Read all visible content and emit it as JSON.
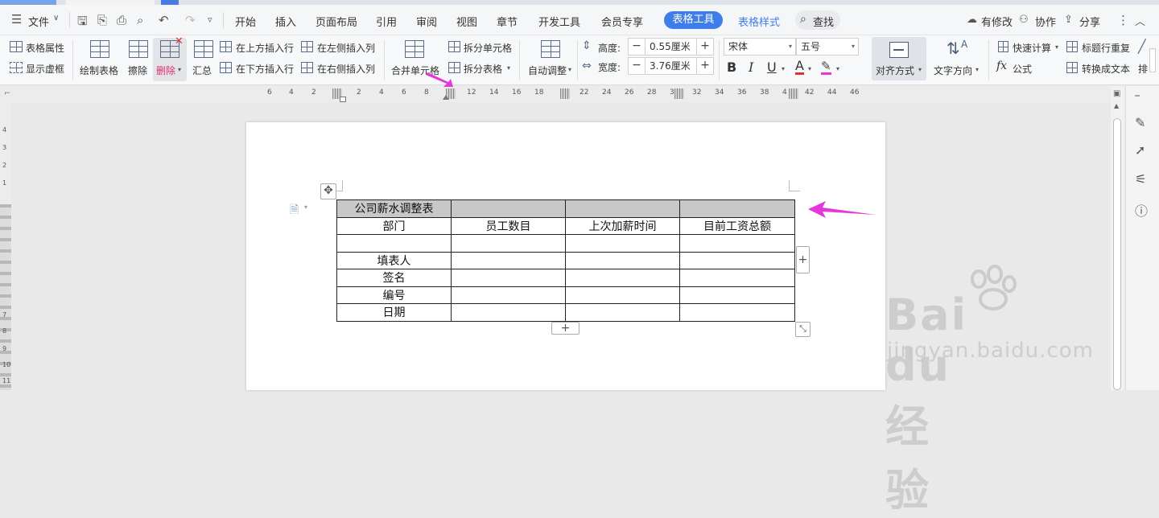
{
  "menubar": {
    "file": "文件",
    "tabs": [
      "开始",
      "插入",
      "页面布局",
      "引用",
      "审阅",
      "视图",
      "章节",
      "开发工具",
      "会员专享"
    ],
    "active_tab": "表格工具",
    "style_tab": "表格样式",
    "search": "查找",
    "modified": "有修改",
    "collab": "协作",
    "share": "分享"
  },
  "ribbon": {
    "table_props": "表格属性",
    "show_grid": "显示虚框",
    "draw_table": "绘制表格",
    "erase": "擦除",
    "delete": "删除",
    "summary": "汇总",
    "insert_above": "在上方插入行",
    "insert_below": "在下方插入行",
    "insert_left": "在左侧插入列",
    "insert_right": "在右侧插入列",
    "merge_cells": "合并单元格",
    "split_cells": "拆分单元格",
    "split_table": "拆分表格",
    "auto_adjust": "自动调整",
    "height_label": "高度:",
    "height_value": "0.55厘米",
    "width_label": "宽度:",
    "width_value": "3.76厘米",
    "font_name": "宋体",
    "font_size": "五号",
    "bold": "B",
    "italic": "I",
    "underline": "U",
    "font_color": "A",
    "alignment": "对齐方式",
    "text_direction": "文字方向",
    "quick_calc": "快速计算",
    "formula": "公式",
    "repeat_header": "标题行重复",
    "convert_text": "转换成文本",
    "more": "排"
  },
  "ruler": {
    "ticks": [
      "6",
      "4",
      "2",
      "2",
      "4",
      "6",
      "8",
      "12",
      "14",
      "16",
      "18",
      "22",
      "24",
      "26",
      "28",
      "3",
      "32",
      "34",
      "36",
      "38",
      "4",
      "42",
      "44",
      "46"
    ]
  },
  "vruler": {
    "ticks": [
      "4",
      "3",
      "2",
      "1",
      "7",
      "8",
      "9",
      "10",
      "11"
    ]
  },
  "table": {
    "title": "公司薪水调整表",
    "headers": [
      "部门",
      "员工数目",
      "上次加薪时间",
      "目前工资总额"
    ],
    "row_labels": [
      "",
      "填表人",
      "签名",
      "编号",
      "日期"
    ]
  },
  "watermark": {
    "brand": "Bai du 经验",
    "url": "jingyan.baidu.com"
  },
  "colors": {
    "accent": "#3f7ee8",
    "arrow": "#e637d8",
    "header_fill": "#c8c8c8"
  }
}
